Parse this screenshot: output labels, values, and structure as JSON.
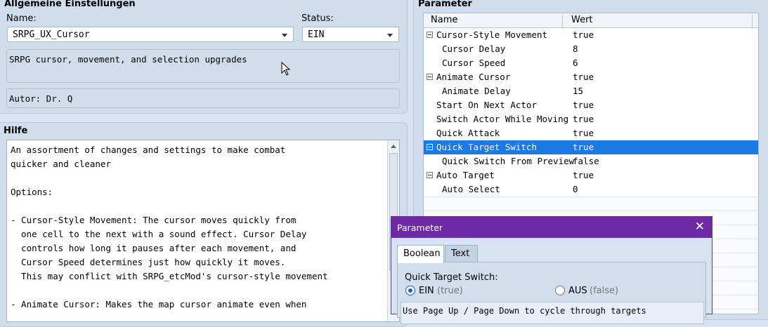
{
  "general": {
    "title": "Allgemeine Einstellungen",
    "name_label": "Name:",
    "name_value": "SRPG_UX_Cursor",
    "status_label": "Status:",
    "status_value": "EIN",
    "description": "SRPG cursor, movement, and selection upgrades",
    "author": "Autor: Dr. Q"
  },
  "help": {
    "title": "Hilfe",
    "lines": [
      "An assortment of changes and settings to make combat",
      "quicker and cleaner",
      "",
      "Options:",
      "",
      "- Cursor-Style Movement: The cursor moves quickly from",
      "  one cell to the next with a sound effect. Cursor Delay",
      "  controls how long it pauses after each movement, and",
      "  Cursor Speed determines just how quickly it moves.",
      "  This may conflict with SRPG_etcMod's cursor-style movement",
      "",
      "- Animate Cursor: Makes the map cursor animate even when"
    ]
  },
  "params": {
    "title": "Parameter",
    "col_name": "Name",
    "col_value": "Wert",
    "rows": [
      {
        "name": "Cursor-Style Movement",
        "value": "true",
        "level": 0,
        "collapsible": true,
        "selected": false
      },
      {
        "name": "Cursor Delay",
        "value": "8",
        "level": 1,
        "collapsible": false,
        "selected": false
      },
      {
        "name": "Cursor Speed",
        "value": "6",
        "level": 1,
        "collapsible": false,
        "selected": false
      },
      {
        "name": "Animate Cursor",
        "value": "true",
        "level": 0,
        "collapsible": true,
        "selected": false
      },
      {
        "name": "Animate Delay",
        "value": "15",
        "level": 1,
        "collapsible": false,
        "selected": false
      },
      {
        "name": "Start On Next Actor",
        "value": "true",
        "level": 0,
        "collapsible": false,
        "selected": false
      },
      {
        "name": "Switch Actor While Moving",
        "value": "true",
        "level": 0,
        "collapsible": false,
        "selected": false
      },
      {
        "name": "Quick Attack",
        "value": "true",
        "level": 0,
        "collapsible": false,
        "selected": false
      },
      {
        "name": "Quick Target Switch",
        "value": "true",
        "level": 0,
        "collapsible": true,
        "selected": true
      },
      {
        "name": "Quick Switch From Preview",
        "value": "false",
        "level": 1,
        "collapsible": false,
        "selected": false
      },
      {
        "name": "Auto Target",
        "value": "true",
        "level": 0,
        "collapsible": true,
        "selected": false
      },
      {
        "name": "Auto Select",
        "value": "0",
        "level": 1,
        "collapsible": false,
        "selected": false
      }
    ]
  },
  "dialog": {
    "title": "Parameter",
    "close_glyph": "✕",
    "tabs": [
      "Boolean",
      "Text"
    ],
    "active_tab": 0,
    "field_label": "Quick Target Switch:",
    "option_on": "EIN",
    "option_on_hint": "(true)",
    "option_off": "AUS",
    "option_off_hint": "(false)",
    "selected_option": "on",
    "hint_text": "Use Page Up / Page Down to cycle through targets"
  },
  "colors": {
    "accent": "#1a7ae6",
    "dialog_title": "#6e2aa5"
  }
}
